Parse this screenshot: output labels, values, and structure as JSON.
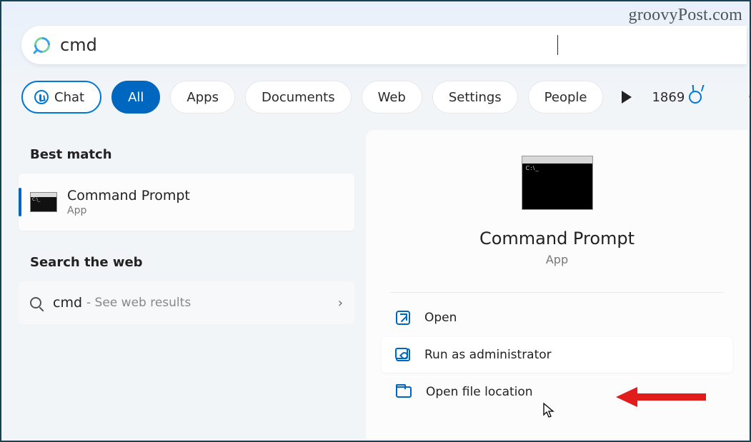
{
  "watermark": "groovyPost.com",
  "search": {
    "query": "cmd"
  },
  "filters": {
    "chat": "Chat",
    "all": "All",
    "apps": "Apps",
    "documents": "Documents",
    "web": "Web",
    "settings": "Settings",
    "people": "People"
  },
  "rewards_points": "1869",
  "left": {
    "best_match_header": "Best match",
    "best_match": {
      "title": "Command Prompt",
      "subtitle": "App"
    },
    "search_web_header": "Search the web",
    "web_item": {
      "query": "cmd",
      "hint": "- See web results"
    }
  },
  "detail": {
    "title": "Command Prompt",
    "subtitle": "App",
    "actions": {
      "open": "Open",
      "run_admin": "Run as administrator",
      "open_location": "Open file location"
    }
  }
}
